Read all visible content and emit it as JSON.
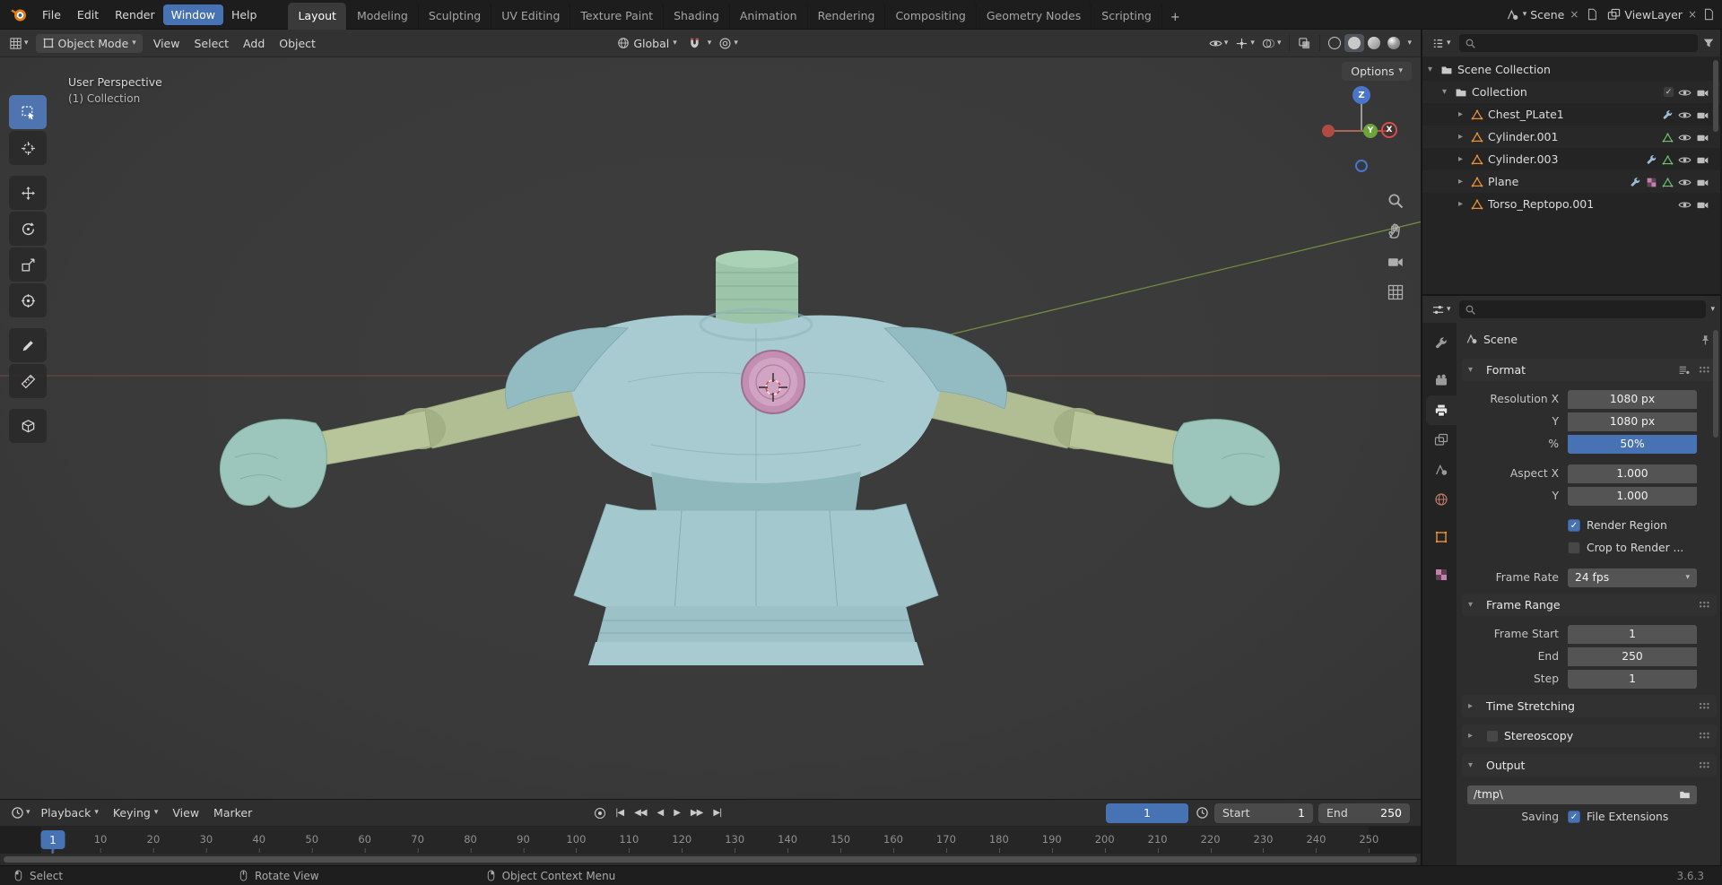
{
  "colors": {
    "accent_blue": "#4772b3",
    "mesh_icon_orange": "#e8913a",
    "axis_x_red": "#d35048",
    "axis_y_green": "#6da33c",
    "axis_z_blue": "#4a76c9",
    "viewport_bg": "#3b3b3b",
    "armor_teal": "#a7cbd0",
    "arm_olive": "#b3bf94",
    "disc_pink": "#d2a4c4"
  },
  "icons": {
    "chevron_down": "▾",
    "disclosure_closed": "▸",
    "disclosure_open": "▾",
    "check": "✓",
    "close": "×",
    "plus": "+",
    "jump_start": "|◀",
    "prev_key": "◀◀",
    "play_back": "◀",
    "play": "▶",
    "next_key": "▶▶",
    "jump_end": "▶|"
  },
  "topbar": {
    "menus": [
      "File",
      "Edit",
      "Render",
      "Window",
      "Help"
    ],
    "workspaces": [
      "Layout",
      "Modeling",
      "Sculpting",
      "UV Editing",
      "Texture Paint",
      "Shading",
      "Animation",
      "Rendering",
      "Compositing",
      "Geometry Nodes",
      "Scripting"
    ],
    "scene_label": "Scene",
    "viewlayer_label": "ViewLayer"
  },
  "viewport_header": {
    "mode": "Object Mode",
    "menus": [
      "View",
      "Select",
      "Add",
      "Object"
    ],
    "orientation": "Global",
    "options_label": "Options"
  },
  "viewport": {
    "perspective_text": "User Perspective",
    "collection_text": "(1) Collection",
    "axis_labels": {
      "x": "X",
      "y": "Y",
      "z": "Z"
    }
  },
  "outliner": {
    "scene_collection": "Scene Collection",
    "collection": "Collection",
    "items": [
      {
        "name": "Chest_PLate1"
      },
      {
        "name": "Cylinder.001"
      },
      {
        "name": "Cylinder.003"
      },
      {
        "name": "Plane"
      },
      {
        "name": "Torso_Reptopo.001"
      }
    ]
  },
  "properties": {
    "breadcrumb": "Scene",
    "format": {
      "title": "Format",
      "resolution_x_label": "Resolution X",
      "resolution_x_value": "1080 px",
      "resolution_y_label": "Y",
      "resolution_y_value": "1080 px",
      "percent_label": "%",
      "percent_value": "50%",
      "aspect_x_label": "Aspect X",
      "aspect_x_value": "1.000",
      "aspect_y_label": "Y",
      "aspect_y_value": "1.000",
      "render_region_label": "Render Region",
      "crop_label": "Crop to Render ...",
      "frame_rate_label": "Frame Rate",
      "frame_rate_value": "24 fps"
    },
    "frame_range": {
      "title": "Frame Range",
      "frame_start_label": "Frame Start",
      "frame_start_value": "1",
      "end_label": "End",
      "end_value": "250",
      "step_label": "Step",
      "step_value": "1"
    },
    "time_stretching_title": "Time Stretching",
    "stereoscopy_title": "Stereoscopy",
    "output": {
      "title": "Output",
      "path_value": "/tmp\\",
      "saving_label": "Saving",
      "file_extensions_label": "File Extensions"
    }
  },
  "timeline": {
    "menus": [
      "Playback",
      "Keying",
      "View",
      "Marker"
    ],
    "current_frame": "1",
    "playhead_frame": "1",
    "start_label": "Start",
    "start_value": "1",
    "end_label": "End",
    "end_value": "250",
    "ticks": [
      1,
      10,
      20,
      30,
      40,
      50,
      60,
      70,
      80,
      90,
      100,
      110,
      120,
      130,
      140,
      150,
      160,
      170,
      180,
      190,
      200,
      210,
      220,
      230,
      240,
      250
    ]
  },
  "statusbar": {
    "select_label": "Select",
    "rotate_label": "Rotate View",
    "context_label": "Object Context Menu",
    "version": "3.6.3"
  }
}
